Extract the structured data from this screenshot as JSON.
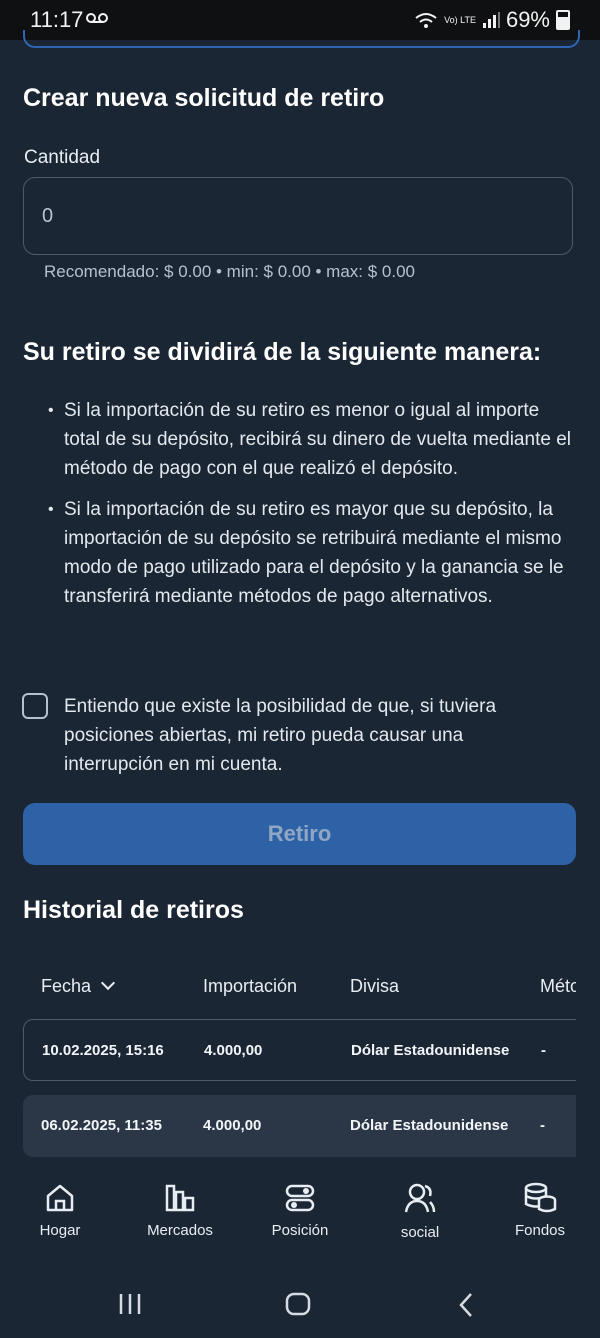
{
  "status_bar": {
    "time": "11:17",
    "voicemail_icon": "voicemail-icon",
    "network_label": "Vo) LTE",
    "battery": "69%"
  },
  "form": {
    "title": "Crear nueva solicitud de retiro",
    "amount_label": "Cantidad",
    "amount_value": "0",
    "hint": "Recomendado: $ 0.00 • min: $ 0.00 • max: $ 0.00",
    "split_title": "Su retiro se dividirá de la siguiente manera:",
    "bullets": [
      "Si la importación de su retiro es menor o igual al importe total de su depósito, recibirá su dinero de vuelta mediante el método de pago con el que realizó el depósito.",
      "Si la importación de su retiro es mayor que su depósito, la importación de su depósito se retribuirá mediante el mismo modo de pago utilizado para el depósito y la ganancia se le transferirá mediante métodos de pago alternativos."
    ],
    "checkbox_text": "Entiendo que existe la posibilidad de que, si tuviera posiciones abiertas, mi retiro pueda causar una interrupción en mi cuenta.",
    "submit_label": "Retiro"
  },
  "history": {
    "title": "Historial de retiros",
    "columns": [
      "Fecha",
      "Importación",
      "Divisa",
      "Méto"
    ],
    "rows": [
      [
        "10.02.2025, 15:16",
        "4.000,00",
        "Dólar Estadounidense",
        "-"
      ],
      [
        "06.02.2025, 11:35",
        "4.000,00",
        "Dólar Estadounidense",
        "-"
      ]
    ]
  },
  "bottom_nav": {
    "items": [
      {
        "label": "Hogar",
        "icon": "home-icon"
      },
      {
        "label": "Mercados",
        "icon": "bar-chart-icon"
      },
      {
        "label": "Posición",
        "icon": "toggle-icon"
      },
      {
        "label": "social",
        "icon": "users-icon"
      },
      {
        "label": "Fondos",
        "icon": "coins-icon"
      }
    ]
  },
  "colors": {
    "background": "#1b2634",
    "accent": "#2e62a7",
    "row_highlight": "#2b3746"
  }
}
